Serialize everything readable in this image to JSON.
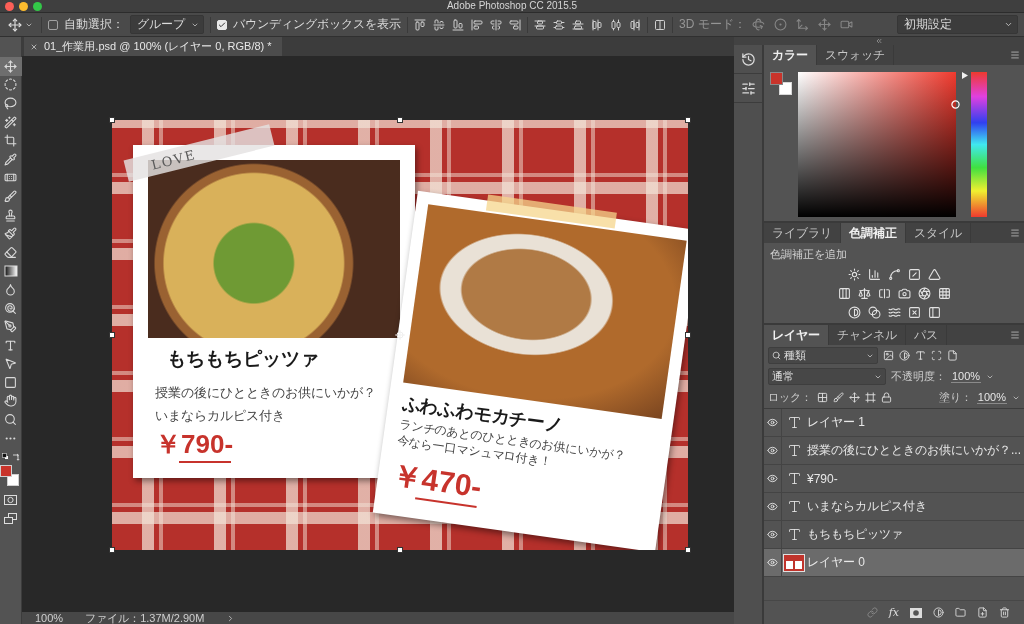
{
  "window": {
    "title": "Adobe Photoshop CC 2015.5"
  },
  "options_bar": {
    "auto_select": {
      "label": "自動選択：",
      "checked": false
    },
    "auto_select_target": {
      "value": "グループ"
    },
    "transform_controls": {
      "label": "バウンディングボックスを表示",
      "checked": true
    },
    "mode_3d": {
      "label": "3D モード：",
      "disabled": true
    },
    "workspace": {
      "value": "初期設定"
    }
  },
  "tools": [
    {
      "selected": true
    },
    {
      "selected": false
    },
    {
      "selected": false
    },
    {
      "selected": false
    },
    {
      "selected": false
    },
    {
      "selected": false
    },
    {
      "selected": false
    },
    {
      "selected": false
    },
    {
      "selected": false
    },
    {
      "selected": false
    },
    {
      "selected": false
    },
    {
      "selected": false
    },
    {
      "selected": false
    },
    {
      "selected": false
    },
    {
      "selected": false
    },
    {
      "selected": false
    },
    {
      "selected": false
    },
    {
      "selected": false
    },
    {
      "selected": false
    },
    {
      "selected": false
    },
    {
      "selected": false
    }
  ],
  "swatches": {
    "foreground": {
      "color": "#c9342b"
    },
    "background": {
      "color": "#ffffff"
    }
  },
  "document_tab": {
    "title": "01_作業用.psd @ 100% (レイヤー 0, RGB/8) *",
    "selected": true
  },
  "canvas": {
    "tape_label": "LOVE",
    "cards": [
      {
        "title": "もちもちピッツァ",
        "lines": [
          "授業の後にひとときのお供にいかが？",
          "いまならカルピス付き"
        ],
        "price": "￥790-",
        "tilted": false
      },
      {
        "title": "ふわふわモカチーノ",
        "lines": [
          "ランチのあとのひとときのお供にいかが？",
          "今なら一口マシュマロ付き！"
        ],
        "price": "￥470-",
        "tilted": true
      }
    ]
  },
  "status_bar": {
    "zoom": "100%",
    "file_size": "ファイル：1.37M/2.90M"
  },
  "color_panel": {
    "tabs": [
      {
        "label": "カラー",
        "selected": true
      },
      {
        "label": "スウォッチ",
        "selected": false
      }
    ],
    "hue_slider": {
      "level": 1
    }
  },
  "adjustments_panel": {
    "tabs": [
      {
        "label": "ライブラリ",
        "selected": false
      },
      {
        "label": "色調補正",
        "selected": true
      },
      {
        "label": "スタイル",
        "selected": false
      }
    ],
    "heading": "色調補正を追加"
  },
  "layers_panel": {
    "tabs": [
      {
        "label": "レイヤー",
        "selected": true
      },
      {
        "label": "チャンネル",
        "selected": false
      },
      {
        "label": "パス",
        "selected": false
      }
    ],
    "filter": {
      "value": "種類"
    },
    "blend_mode": {
      "value": "通常"
    },
    "opacity": {
      "label": "不透明度：",
      "value": "100%"
    },
    "lock": {
      "label": "ロック："
    },
    "fill": {
      "label": "塗り：",
      "value": "100%"
    },
    "layers": [
      {
        "name": "レイヤー 1",
        "kind": "text",
        "visible": true,
        "selected": false
      },
      {
        "name": "授業の後にひとときのお供にいかが？...",
        "kind": "text",
        "visible": true,
        "selected": false
      },
      {
        "name": "¥790-",
        "kind": "text",
        "visible": true,
        "selected": false
      },
      {
        "name": "いまならカルピス付き",
        "kind": "text",
        "visible": true,
        "selected": false
      },
      {
        "name": "もちもちピッツァ",
        "kind": "text",
        "visible": true,
        "selected": false
      },
      {
        "name": "レイヤー 0",
        "kind": "image",
        "visible": true,
        "selected": true
      }
    ],
    "fx": "fx"
  }
}
